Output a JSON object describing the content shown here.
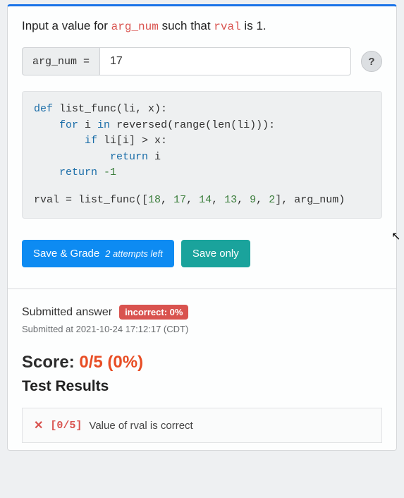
{
  "prompt": {
    "prefix": "Input a value for ",
    "var1": "arg_num",
    "mid": " such that ",
    "var2": "rval",
    "suffix": " is ",
    "target": "1",
    "end": "."
  },
  "input": {
    "label": "arg_num =",
    "value": "17"
  },
  "help": {
    "glyph": "?"
  },
  "code": {
    "defLine": "def list_func(li, x):",
    "forLine": "    for i in reversed(range(len(li))):",
    "ifLine": "        if li[i] > x:",
    "retLine": "            return i",
    "retNeg": "    return -1",
    "call": "rval = list_func([18, 17, 14, 13, 9, 2], arg_num)"
  },
  "buttons": {
    "saveGrade": "Save & Grade",
    "attempts": "2 attempts left",
    "saveOnly": "Save only"
  },
  "submitted": {
    "label": "Submitted answer",
    "badge": "incorrect: 0%",
    "time": "Submitted at 2021-10-24 17:12:17 (CDT)"
  },
  "score": {
    "prefix": "Score: ",
    "value": "0/5 (0%)"
  },
  "results": {
    "heading": "Test Results",
    "item": {
      "points": "[0/5]",
      "text": "Value of rval is correct"
    }
  }
}
